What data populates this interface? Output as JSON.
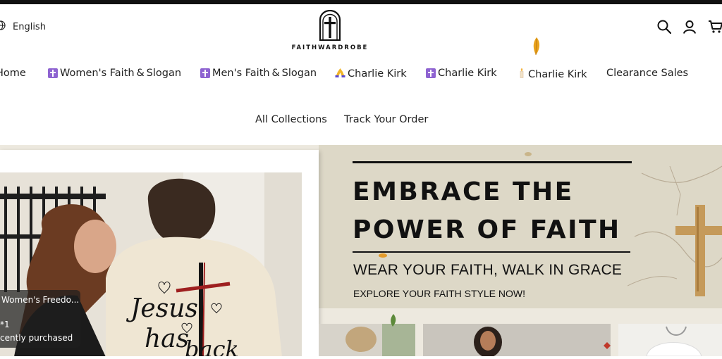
{
  "header": {
    "language_label": "English",
    "brand_name": "FAITHWARDROBE",
    "icons": [
      "globe-icon",
      "search-icon",
      "account-icon",
      "cart-icon"
    ]
  },
  "nav": {
    "row1": [
      {
        "label": "Home",
        "icon": ""
      },
      {
        "label": "Women's Faith & Slogan",
        "icon": "cross-box-icon"
      },
      {
        "label": "Men's Faith & Slogan",
        "icon": "cross-box-icon"
      },
      {
        "label": "Charlie Kirk",
        "icon": "praying-hands-icon"
      },
      {
        "label": "Charlie Kirk",
        "icon": "cross-box-icon"
      },
      {
        "label": "Charlie Kirk",
        "icon": "candle-icon"
      },
      {
        "label": "Clearance Sales",
        "icon": ""
      }
    ],
    "row2": [
      {
        "label": "All Collections"
      },
      {
        "label": "Track Your Order"
      }
    ]
  },
  "hero": {
    "title_line1": "EMBRACE THE",
    "title_line2": "POWER OF FAITH",
    "subtitle": "WEAR YOUR FAITH, WALK IN GRACE",
    "cta": "EXPLORE YOUR FAITH STYLE NOW!",
    "shirt_text_line1": "Jesus",
    "shirt_text_line2": "has",
    "shirt_text_line3": "back"
  },
  "purchase_popup": {
    "product": "Women's Freedo...",
    "quantity": "*1",
    "status": "cently purchased"
  },
  "colors": {
    "top_bar": "#111111",
    "accent_purple": "#8e63d1",
    "banner_bg": "#ddd8c7",
    "hero_bg": "#ede9df"
  }
}
